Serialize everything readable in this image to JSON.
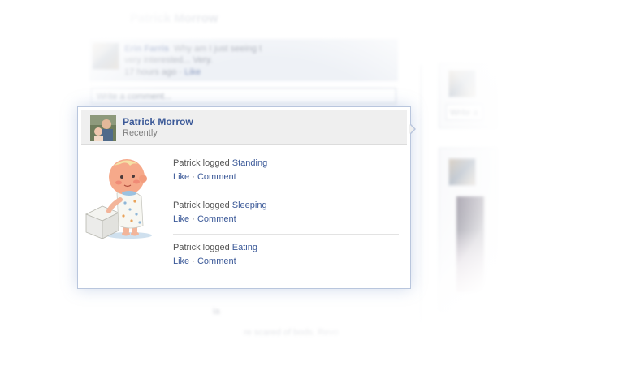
{
  "background": {
    "profile_name": "Patrick Morrow",
    "comment": {
      "author": "Erin Farris",
      "text_line1": "Why am I just seeing t",
      "text_line2": "very interested... Very.",
      "time": "17 hours ago",
      "separator": "·",
      "like_label": "Like"
    },
    "comment_input_placeholder": "Write a comment...",
    "side_input_placeholder": "Write a",
    "faded_text_1": "ia",
    "faded_text_2": "re scared of bods. Revo"
  },
  "popup": {
    "header": {
      "name": "Patrick Morrow",
      "time": "Recently"
    },
    "activities": [
      {
        "prefix": "Patrick logged",
        "activity": "Standing",
        "like_label": "Like",
        "separator": "·",
        "comment_label": "Comment"
      },
      {
        "prefix": "Patrick logged",
        "activity": "Sleeping",
        "like_label": "Like",
        "separator": "·",
        "comment_label": "Comment"
      },
      {
        "prefix": "Patrick logged",
        "activity": "Eating",
        "like_label": "Like",
        "separator": "·",
        "comment_label": "Comment"
      }
    ]
  },
  "colors": {
    "link": "#3b5998",
    "muted_text": "#7f7f7f",
    "header_bg": "#efefef",
    "popup_border": "#b9c6dd"
  },
  "icons": {
    "header_avatar": "profile-photo",
    "illustration": "baby-standing-illustration"
  }
}
